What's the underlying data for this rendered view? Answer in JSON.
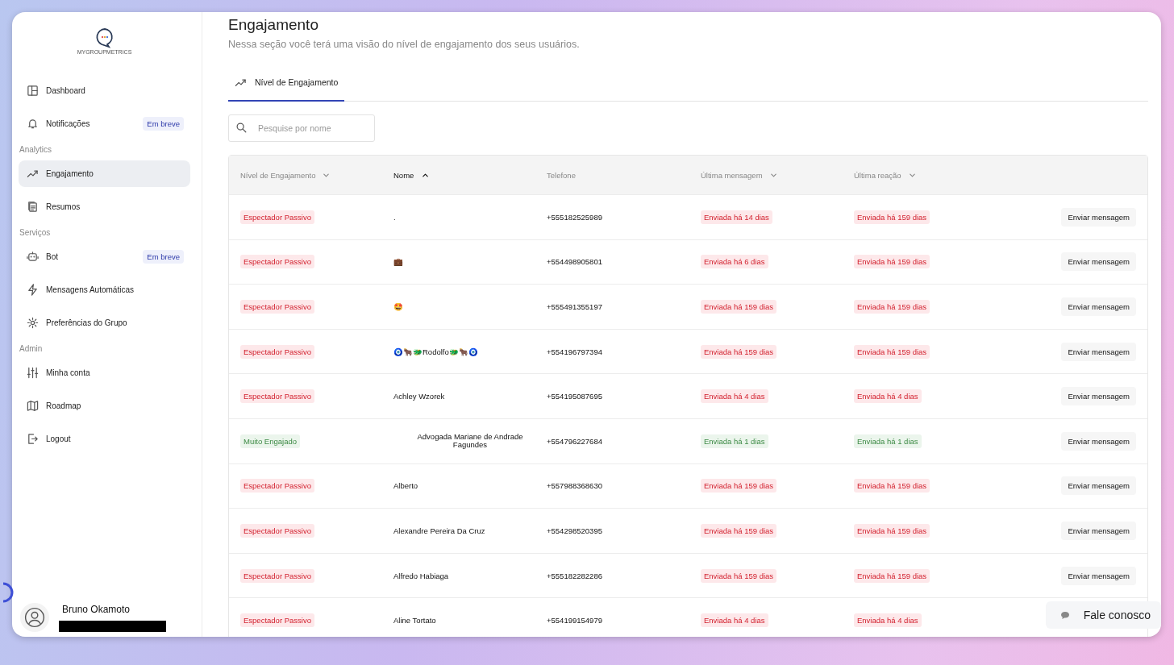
{
  "sidebar": {
    "logo_text": "MYGROUPMETRICS",
    "sections": [
      {
        "items": [
          {
            "label": "Dashboard",
            "selected": false
          },
          {
            "label": "Notificações",
            "selected": false,
            "badge": "Em breve"
          }
        ]
      },
      {
        "title": "Analytics",
        "items": [
          {
            "label": "Engajamento",
            "selected": true
          },
          {
            "label": "Resumos",
            "selected": false
          }
        ]
      },
      {
        "title": "Serviços",
        "items": [
          {
            "label": "Bot",
            "selected": false,
            "badge": "Em breve"
          },
          {
            "label": "Mensagens Automáticas",
            "selected": false
          },
          {
            "label": "Preferências do Grupo",
            "selected": false
          }
        ]
      },
      {
        "title": "Admin",
        "items": [
          {
            "label": "Minha conta",
            "selected": false
          },
          {
            "label": "Roadmap",
            "selected": false
          },
          {
            "label": "Logout",
            "selected": false
          }
        ]
      }
    ],
    "user": {
      "name": "Bruno Okamoto"
    }
  },
  "page": {
    "title": "Engajamento",
    "subtitle": "Nessa seção você terá uma visão do nível de engajamento dos seus usuários."
  },
  "tabs": [
    {
      "label": "Nível de Engajamento",
      "selected": true
    }
  ],
  "search": {
    "placeholder": "Pesquise por nome"
  },
  "table": {
    "columns": [
      {
        "label": "Nível de Engajamento",
        "sortable": true,
        "selected": false
      },
      {
        "label": "Nome",
        "sortable": true,
        "selected": true
      },
      {
        "label": "Telefone",
        "sortable": false,
        "selected": false
      },
      {
        "label": "Última mensagem",
        "sortable": true,
        "selected": false
      },
      {
        "label": "Última reação",
        "sortable": true,
        "selected": false
      }
    ],
    "rows": [
      {
        "level": {
          "text": "Espectador Passivo",
          "kind": "negative"
        },
        "name": ".",
        "phone": "+555182525989",
        "last_message": {
          "text": "Enviada há 14 dias",
          "kind": "negative"
        },
        "last_reaction": {
          "text": "Enviada há 159 dias",
          "kind": "negative"
        },
        "action": "Enviar mensagem"
      },
      {
        "level": {
          "text": "Espectador Passivo",
          "kind": "negative"
        },
        "name": "💼",
        "phone": "+554498905801",
        "last_message": {
          "text": "Enviada há 6 dias",
          "kind": "negative"
        },
        "last_reaction": {
          "text": "Enviada há 159 dias",
          "kind": "negative"
        },
        "action": "Enviar mensagem"
      },
      {
        "level": {
          "text": "Espectador Passivo",
          "kind": "negative"
        },
        "name": "🤩",
        "phone": "+555491355197",
        "last_message": {
          "text": "Enviada há 159 dias",
          "kind": "negative"
        },
        "last_reaction": {
          "text": "Enviada há 159 dias",
          "kind": "negative"
        },
        "action": "Enviar mensagem"
      },
      {
        "level": {
          "text": "Espectador Passivo",
          "kind": "negative"
        },
        "name": "🧿🐂🐲Rodolfo🐲🐂🧿",
        "phone": "+554196797394",
        "last_message": {
          "text": "Enviada há 159 dias",
          "kind": "negative"
        },
        "last_reaction": {
          "text": "Enviada há 159 dias",
          "kind": "negative"
        },
        "action": "Enviar mensagem"
      },
      {
        "level": {
          "text": "Espectador Passivo",
          "kind": "negative"
        },
        "name": "Achley Wzorek",
        "phone": "+554195087695",
        "last_message": {
          "text": "Enviada há 4 dias",
          "kind": "negative"
        },
        "last_reaction": {
          "text": "Enviada há 4 dias",
          "kind": "negative"
        },
        "action": "Enviar mensagem"
      },
      {
        "level": {
          "text": "Muito Engajado",
          "kind": "positive"
        },
        "name": "Advogada Mariane de Andrade Fagundes",
        "phone": "+554796227684",
        "last_message": {
          "text": "Enviada há 1 dias",
          "kind": "positive"
        },
        "last_reaction": {
          "text": "Enviada há 1 dias",
          "kind": "positive"
        },
        "action": "Enviar mensagem"
      },
      {
        "level": {
          "text": "Espectador Passivo",
          "kind": "negative"
        },
        "name": "Alberto",
        "phone": "+557988368630",
        "last_message": {
          "text": "Enviada há 159 dias",
          "kind": "negative"
        },
        "last_reaction": {
          "text": "Enviada há 159 dias",
          "kind": "negative"
        },
        "action": "Enviar mensagem"
      },
      {
        "level": {
          "text": "Espectador Passivo",
          "kind": "negative"
        },
        "name": "Alexandre Pereira Da Cruz",
        "phone": "+554298520395",
        "last_message": {
          "text": "Enviada há 159 dias",
          "kind": "negative"
        },
        "last_reaction": {
          "text": "Enviada há 159 dias",
          "kind": "negative"
        },
        "action": "Enviar mensagem"
      },
      {
        "level": {
          "text": "Espectador Passivo",
          "kind": "negative"
        },
        "name": "Alfredo Habiaga",
        "phone": "+555182282286",
        "last_message": {
          "text": "Enviada há 159 dias",
          "kind": "negative"
        },
        "last_reaction": {
          "text": "Enviada há 159 dias",
          "kind": "negative"
        },
        "action": "Enviar mensagem"
      },
      {
        "level": {
          "text": "Espectador Passivo",
          "kind": "negative"
        },
        "name": "Aline Tortato",
        "phone": "+554199154979",
        "last_message": {
          "text": "Enviada há 4 dias",
          "kind": "negative"
        },
        "last_reaction": {
          "text": "Enviada há 4 dias",
          "kind": "negative"
        }
      }
    ]
  },
  "chat_button": {
    "label": "Fale conosco"
  }
}
